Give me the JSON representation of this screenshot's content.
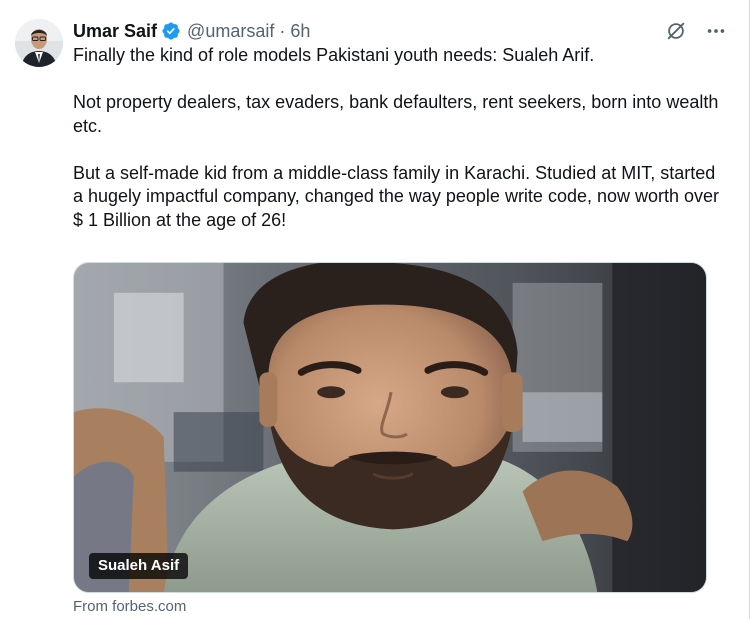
{
  "author": {
    "display_name": "Umar Saif",
    "handle": "@umarsaif",
    "separator": "·",
    "time": "6h",
    "verified": true
  },
  "icons": {
    "verified": "verified-badge-icon",
    "grok": "grok-icon",
    "more": "more-icon"
  },
  "tweet": {
    "paragraphs": [
      "Finally the kind of role models Pakistani youth needs: Sualeh Arif.",
      "Not property dealers, tax evaders, bank defaulters, rent seekers, born into wealth etc.",
      "But a self-made kid from a middle-class family in Karachi. Studied at MIT, started a hugely impactful company, changed the way people write code, now worth over $ 1 Billion at the age of 26!"
    ]
  },
  "card": {
    "label": "Sualeh Asif",
    "source": "From forbes.com"
  },
  "colors": {
    "text": "#0f1419",
    "secondary": "#536471",
    "verified_blue": "#1d9bf0",
    "border": "#cfd9de"
  }
}
